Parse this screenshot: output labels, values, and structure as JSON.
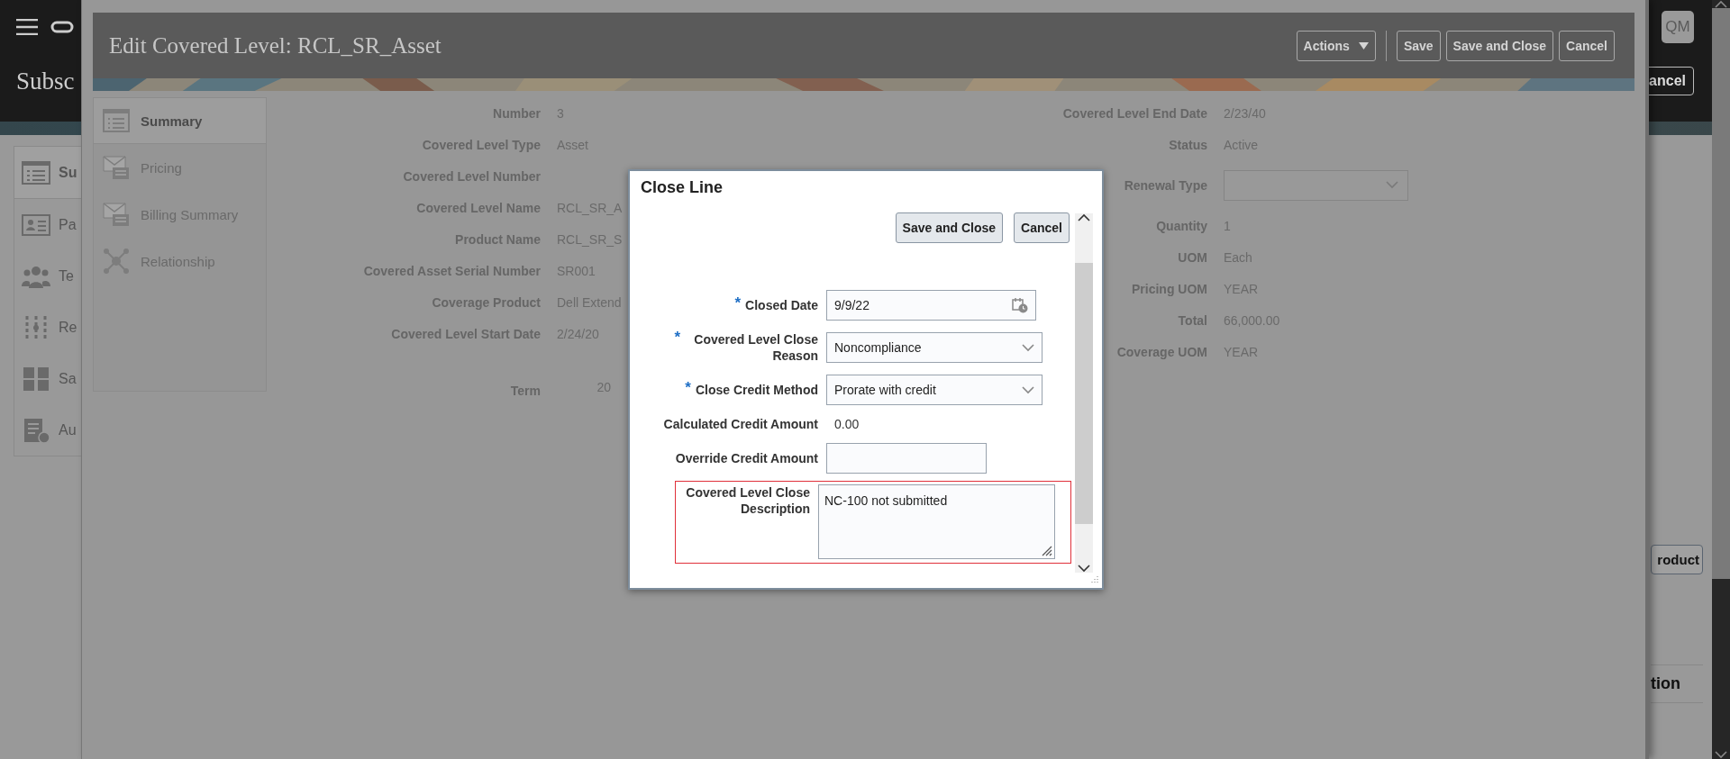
{
  "app": {
    "page_title": "Subsc",
    "avatar": "QM",
    "header_button": "ancel",
    "nav": [
      {
        "label": "Su",
        "selected": true
      },
      {
        "label": "Pa",
        "selected": false
      },
      {
        "label": "Te",
        "selected": false
      },
      {
        "label": "Re",
        "selected": false
      },
      {
        "label": "Sa",
        "selected": false
      },
      {
        "label": "Au",
        "selected": false
      }
    ],
    "side_button": "roduct",
    "side_heading": "tion"
  },
  "edit_dialog": {
    "title": "Edit Covered Level: RCL_SR_Asset",
    "actions": [
      {
        "label": "Actions",
        "kind": "menu"
      },
      {
        "label": "Save",
        "kind": "button"
      },
      {
        "label": "Save and Close",
        "kind": "button"
      },
      {
        "label": "Cancel",
        "kind": "button"
      }
    ],
    "nav": [
      {
        "label": "Summary",
        "selected": true
      },
      {
        "label": "Pricing",
        "selected": false
      },
      {
        "label": "Billing Summary",
        "selected": false
      },
      {
        "label": "Relationship",
        "selected": false
      }
    ],
    "left_fields": [
      {
        "label": "Number",
        "value": "3",
        "kind": "text"
      },
      {
        "label": "Covered Level Type",
        "value": "Asset",
        "kind": "text"
      },
      {
        "label": "Covered Level Number",
        "kind": "text"
      },
      {
        "label": "Covered Level Name",
        "value": "RCL_SR_A",
        "kind": "text"
      },
      {
        "label": "Product Name",
        "value": "RCL_SR_S",
        "kind": "text"
      },
      {
        "label": "Covered Asset Serial Number",
        "value": "SR001",
        "kind": "text"
      },
      {
        "label": "Coverage Product",
        "value": "Dell Extend",
        "kind": "text"
      },
      {
        "label": "Covered Level Start Date",
        "value": "2/24/20",
        "kind": "text"
      },
      {
        "label": "Term",
        "value": "20",
        "kind": "number"
      }
    ],
    "right_fields": [
      {
        "label": "Covered Level End Date",
        "value": "2/23/40",
        "kind": "text"
      },
      {
        "label": "Status",
        "value": "Active",
        "kind": "text"
      },
      {
        "label": "Renewal Type",
        "kind": "select"
      },
      {
        "label": "Quantity",
        "value": "1",
        "kind": "text"
      },
      {
        "label": "UOM",
        "value": "Each",
        "kind": "text"
      },
      {
        "label": "Pricing UOM",
        "value": "YEAR",
        "kind": "text"
      },
      {
        "label": "Total",
        "value": "66,000.00",
        "kind": "text"
      },
      {
        "label": "Coverage UOM",
        "value": "YEAR",
        "kind": "text"
      }
    ]
  },
  "close_dialog": {
    "title": "Close Line",
    "buttons": [
      {
        "label": "Save and Close"
      },
      {
        "label": "Cancel"
      }
    ],
    "fields": [
      {
        "label": "Closed Date",
        "required_mark": "*",
        "value": "9/9/22",
        "kind": "date"
      },
      {
        "label": "Covered Level Close Reason",
        "required_mark": "*",
        "value": "Noncompliance",
        "kind": "select"
      },
      {
        "label": "Close Credit Method",
        "required_mark": "*",
        "value": "Prorate with credit",
        "kind": "select"
      },
      {
        "label": "Calculated Credit Amount",
        "value": "0.00",
        "kind": "text"
      },
      {
        "label": "Override Credit Amount",
        "kind": "input"
      }
    ],
    "description": {
      "label": "Covered Level Close Description",
      "value": "NC-100 not submitted",
      "highlighted": true
    }
  }
}
